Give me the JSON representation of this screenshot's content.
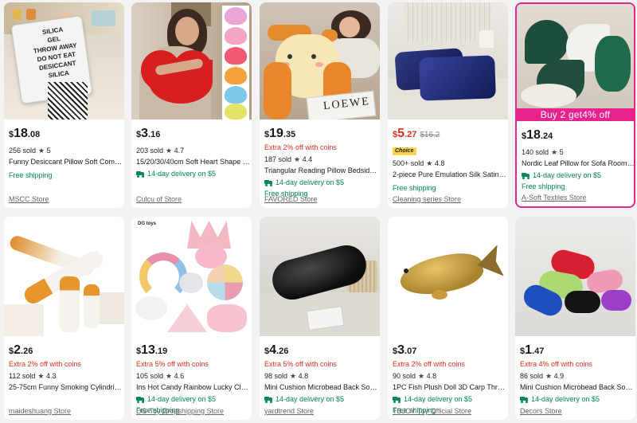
{
  "products": [
    {
      "currency": "$",
      "dollars": "18",
      "cents": ".08",
      "sold": "256 sold",
      "rating": "5",
      "title": "Funny Desiccant Pillow Soft Comfor...",
      "shipping": "Free shipping",
      "store": "MSCC Store",
      "image_text": [
        "SILICA",
        "GEL",
        "THROW AWAY",
        "DO NOT EAT",
        "DESICCANT",
        "SILICA"
      ]
    },
    {
      "currency": "$",
      "dollars": "3",
      "cents": ".16",
      "sold": "203 sold",
      "rating": "4.7",
      "title": "15/20/30/40cm Soft Heart Shape P...",
      "delivery": "14-day delivery on $5",
      "store": "Culcu of Store"
    },
    {
      "currency": "$",
      "dollars": "19",
      "cents": ".35",
      "coupon": "Extra 2% off with coins",
      "sold": "187 sold",
      "rating": "4.4",
      "title": "Triangular Reading Pillow Bedside ...",
      "delivery": "14-day delivery on $5",
      "shipping": "Free shipping",
      "store": "FAVORED Store",
      "image_text": [
        "LOEWE"
      ]
    },
    {
      "currency": "$",
      "dollars": "5",
      "cents": ".27",
      "original": "$16.2",
      "badge": "Choice",
      "sold": "500+ sold",
      "rating": "4.8",
      "title": "2-piece Pure Emulation Silk Satin Pi...",
      "shipping": "Free shipping",
      "store": "Cleaning series Store"
    },
    {
      "currency": "$",
      "dollars": "18",
      "cents": ".24",
      "sold": "140 sold",
      "rating": "5",
      "title": "Nordic Leaf Pillow for Sofa Room D...",
      "delivery": "14-day delivery on $5",
      "shipping": "Free shipping",
      "store": "A-Soft Textiles Store",
      "banner": "Buy 2 get4% off"
    },
    {
      "currency": "$",
      "dollars": "2",
      "cents": ".26",
      "coupon": "Extra 2% off with coins",
      "sold": "112 sold",
      "rating": "4.3",
      "title": "25-75cm Funny Smoking Cylindrical...",
      "store": "maideshuang Store"
    },
    {
      "currency": "$",
      "dollars": "13",
      "cents": ".19",
      "coupon": "Extra 5% off with coins",
      "sold": "105 sold",
      "rating": "4.6",
      "title": "Ins Hot Candy Rainbow Lucky Clou...",
      "delivery": "14-day delivery on $5",
      "shipping": "Free shipping",
      "store": "DG-Toy Dropshipping Store",
      "image_brand": "DG toys"
    },
    {
      "currency": "$",
      "dollars": "4",
      "cents": ".26",
      "coupon": "Extra 5% off with coins",
      "sold": "98 sold",
      "rating": "4.8",
      "title": "Mini Cushion Microbead Back Sofa ...",
      "delivery": "14-day delivery on $5",
      "store": "yardtrend Store"
    },
    {
      "currency": "$",
      "dollars": "3",
      "cents": ".07",
      "coupon": "Extra 2% off with coins",
      "sold": "90 sold",
      "rating": "4.8",
      "title": "1PC Fish Plush Doll 3D Carp Throw ...",
      "delivery": "14-day delivery on $5",
      "shipping": "Free shipping",
      "store": "TBJOY Toy Official Store"
    },
    {
      "currency": "$",
      "dollars": "1",
      "cents": ".47",
      "coupon": "Extra 4% off with coins",
      "sold": "86 sold",
      "rating": "4.9",
      "title": "Mini Cushion Microbead Back Sofa ...",
      "delivery": "14-day delivery on $5",
      "store": "Decors Store"
    }
  ],
  "colors": {
    "price_sale": "#e0301e",
    "delivery": "#00875a",
    "banner": "#e8238d",
    "choice_badge": "#fcd34d"
  },
  "icons": {
    "star": "★",
    "truck": "truck-icon"
  }
}
